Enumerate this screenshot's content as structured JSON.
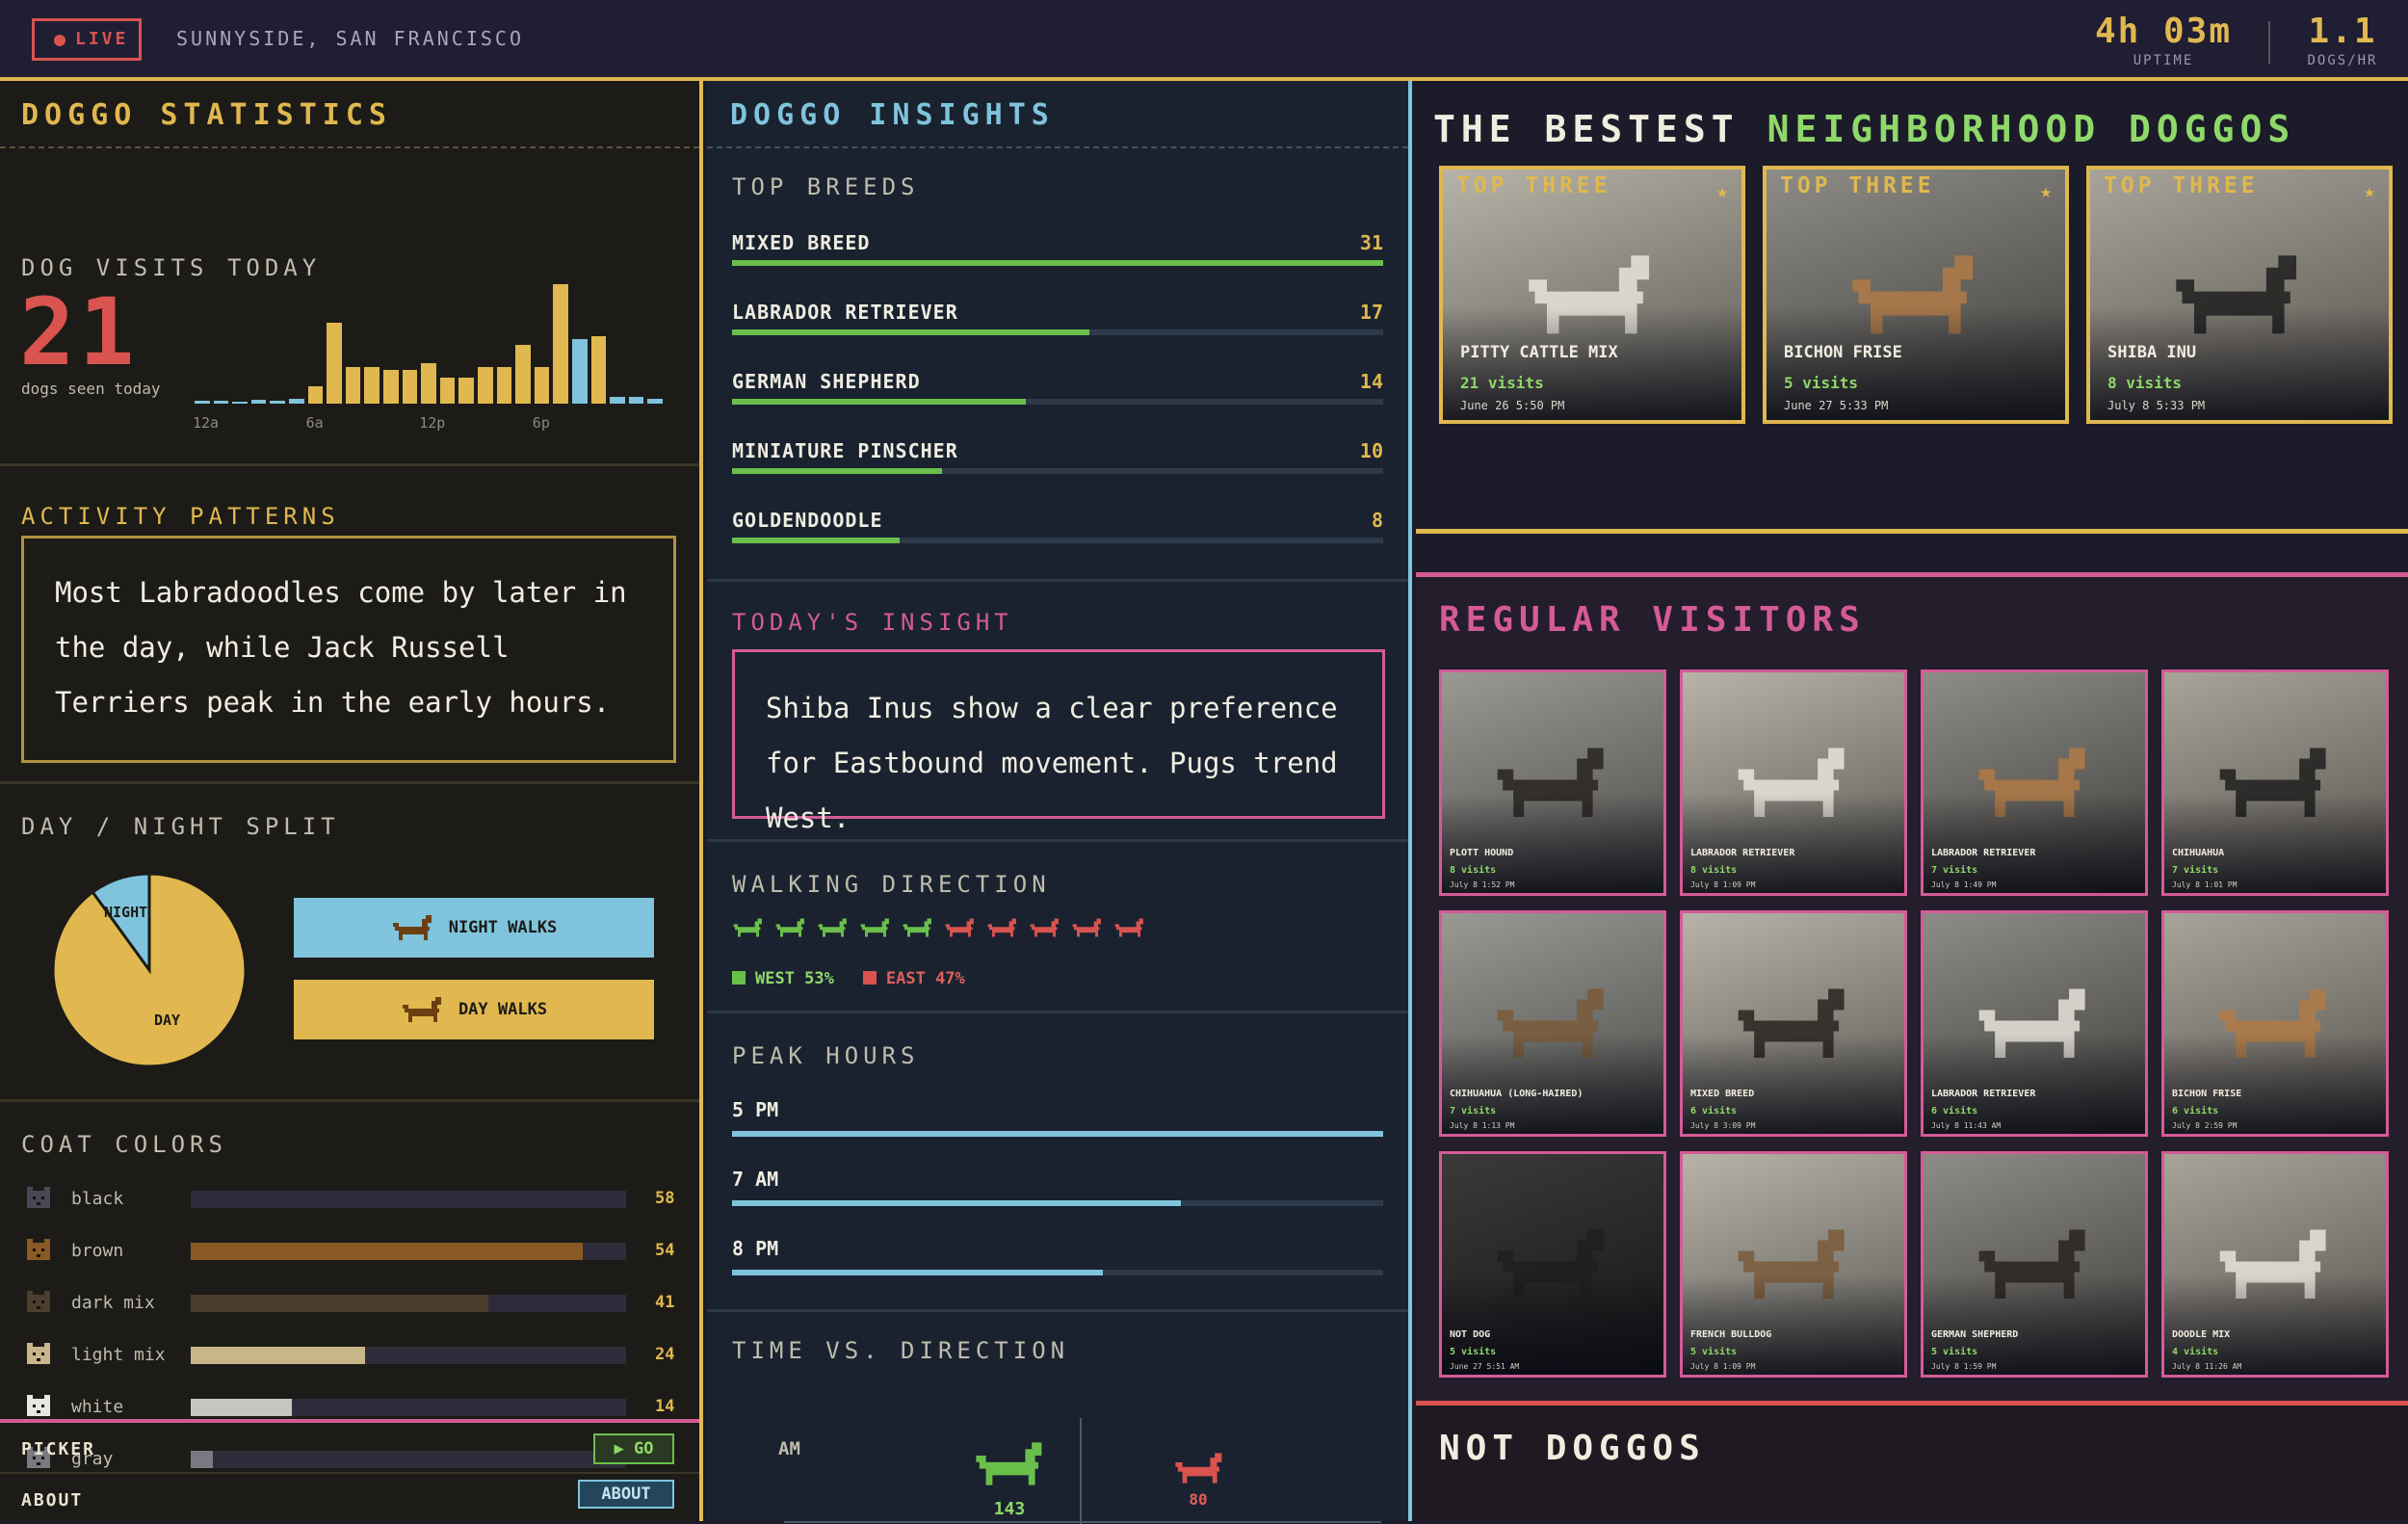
{
  "topbar": {
    "live": "LIVE",
    "location": "SUNNYSIDE, SAN FRANCISCO",
    "uptime_value": "4h 03m",
    "uptime_label": "UPTIME",
    "rate_value": "1.1",
    "rate_label": "DOGS/HR"
  },
  "stats": {
    "title": "DOGGO STATISTICS",
    "visits_title": "DOG VISITS TODAY",
    "visits_count": "21",
    "visits_note": "dogs seen today",
    "hour_labels": [
      "12a",
      "6a",
      "12p",
      "6p"
    ],
    "hourly": [
      0.02,
      0.02,
      0.01,
      0.03,
      0.02,
      0.04,
      0.13,
      0.62,
      0.28,
      0.28,
      0.26,
      0.26,
      0.31,
      0.2,
      0.2,
      0.28,
      0.28,
      0.45,
      0.28,
      0.92,
      0.5,
      0.52,
      0.05,
      0.05,
      0.04
    ],
    "activity_title": "ACTIVITY PATTERNS",
    "activity_text": "Most Labradoodles come by later in the day, while Jack Russell Terriers peak in the early hours.",
    "daynight_title": "DAY / NIGHT SPLIT",
    "night_label": "NIGHT",
    "day_label": "DAY",
    "night_fraction": 0.1,
    "night_walks": "NIGHT WALKS",
    "day_walks": "DAY WALKS",
    "coats_title": "COAT COLORS",
    "coats": [
      {
        "name": "black",
        "value": 58,
        "color": "#2e2c3a"
      },
      {
        "name": "brown",
        "value": 54,
        "color": "#8a5a25"
      },
      {
        "name": "dark mix",
        "value": 41,
        "color": "#4b3e2e"
      },
      {
        "name": "light mix",
        "value": 24,
        "color": "#c9b58a"
      },
      {
        "name": "white",
        "value": 14,
        "color": "#c8c6c0"
      },
      {
        "name": "gray",
        "value": 3,
        "color": "#7a7880"
      }
    ],
    "picker_label": "PICKER",
    "go_label": "▶ GO",
    "about_label": "ABOUT",
    "about_button": "ABOUT"
  },
  "insights": {
    "title": "DOGGO INSIGHTS",
    "breeds_title": "TOP BREEDS",
    "breeds": [
      {
        "name": "MIXED BREED",
        "value": 31
      },
      {
        "name": "LABRADOR RETRIEVER",
        "value": 17
      },
      {
        "name": "GERMAN SHEPHERD",
        "value": 14
      },
      {
        "name": "MINIATURE PINSCHER",
        "value": 10
      },
      {
        "name": "GOLDENDOODLE",
        "value": 8
      }
    ],
    "insight_title": "TODAY'S INSIGHT",
    "insight_text": "Shiba Inus show a clear preference for Eastbound movement. Pugs trend West.",
    "walk_title": "WALKING DIRECTION",
    "west_label": "WEST 53%",
    "east_label": "EAST 47%",
    "west_count": 5,
    "east_count": 5,
    "peak_title": "PEAK HOURS",
    "peaks": [
      {
        "name": "5 PM",
        "fraction": 1.0
      },
      {
        "name": "7 AM",
        "fraction": 0.69
      },
      {
        "name": "8 PM",
        "fraction": 0.57
      }
    ],
    "tvd_title": "TIME VS. DIRECTION",
    "tvd_row": "AM",
    "tvd_west": "143",
    "tvd_east": "80"
  },
  "gallery": {
    "title_plain": "THE BESTEST",
    "title_highlight": "NEIGHBORHOOD DOGGOS",
    "top_tag": "TOP THREE",
    "top": [
      {
        "name": "PITTY CATTLE MIX",
        "visits": "21 visits",
        "date": "June 26 5:50 PM"
      },
      {
        "name": "BICHON FRISE",
        "visits": "5 visits",
        "date": "June 27 5:33 PM"
      },
      {
        "name": "SHIBA INU",
        "visits": "8 visits",
        "date": "July 8 5:33 PM"
      }
    ],
    "regular_title": "REGULAR VISITORS",
    "regular": [
      {
        "name": "PLOTT HOUND",
        "visits": "8 visits",
        "date": "July 8 1:52 PM"
      },
      {
        "name": "LABRADOR RETRIEVER",
        "visits": "8 visits",
        "date": "July 8 1:09 PM"
      },
      {
        "name": "LABRADOR RETRIEVER",
        "visits": "7 visits",
        "date": "July 8 1:49 PM"
      },
      {
        "name": "CHIHUAHUA",
        "visits": "7 visits",
        "date": "July 8 1:01 PM"
      },
      {
        "name": "CHIHUAHUA (LONG-HAIRED)",
        "visits": "7 visits",
        "date": "July 8 1:13 PM"
      },
      {
        "name": "MIXED BREED",
        "visits": "6 visits",
        "date": "July 8 3:09 PM"
      },
      {
        "name": "LABRADOR RETRIEVER",
        "visits": "6 visits",
        "date": "July 8 11:43 AM"
      },
      {
        "name": "BICHON FRISE",
        "visits": "6 visits",
        "date": "July 8 2:59 PM"
      },
      {
        "name": "NOT DOG",
        "visits": "5 visits",
        "date": "June 27 5:51 AM"
      },
      {
        "name": "FRENCH BULLDOG",
        "visits": "5 visits",
        "date": "July 8 1:09 PM"
      },
      {
        "name": "GERMAN SHEPHERD",
        "visits": "5 visits",
        "date": "July 8 1:59 PM"
      },
      {
        "name": "DOODLE MIX",
        "visits": "4 visits",
        "date": "July 8 11:26 AM"
      }
    ],
    "not_title": "NOT DOGGOS"
  },
  "colors": {
    "accent_yellow": "#e0b84f",
    "accent_blue": "#7fc4dc",
    "accent_pink": "#d45b97",
    "accent_green": "#6abf4b",
    "accent_red": "#d9534f"
  }
}
